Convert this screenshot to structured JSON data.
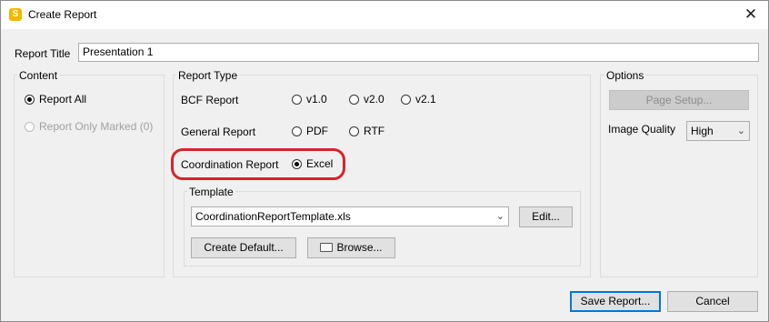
{
  "window": {
    "title": "Create Report",
    "app_icon_letter": "S",
    "close_glyph": "✕"
  },
  "report_title": {
    "label": "Report Title",
    "value": "Presentation 1"
  },
  "content": {
    "legend": "Content",
    "options": [
      {
        "label": "Report All",
        "checked": true,
        "enabled": true
      },
      {
        "label": "Report Only Marked (0)",
        "checked": false,
        "enabled": false
      }
    ]
  },
  "report_type": {
    "legend": "Report Type",
    "bcf": {
      "label": "BCF Report",
      "options": [
        "v1.0",
        "v2.0",
        "v2.1"
      ]
    },
    "general": {
      "label": "General Report",
      "options": [
        "PDF",
        "RTF"
      ]
    },
    "coordination": {
      "label": "Coordination Report",
      "option": "Excel",
      "checked": true
    }
  },
  "template": {
    "legend": "Template",
    "selected": "CoordinationReportTemplate.xls",
    "edit_label": "Edit...",
    "create_default_label": "Create Default...",
    "browse_label": "Browse..."
  },
  "options": {
    "legend": "Options",
    "page_setup_label": "Page Setup...",
    "image_quality_label": "Image Quality",
    "image_quality_value": "High"
  },
  "footer": {
    "save_label": "Save Report...",
    "cancel_label": "Cancel"
  },
  "colors": {
    "highlight": "#d8232a",
    "app_icon": "#f3b800",
    "default_button_border": "#0078d7"
  }
}
